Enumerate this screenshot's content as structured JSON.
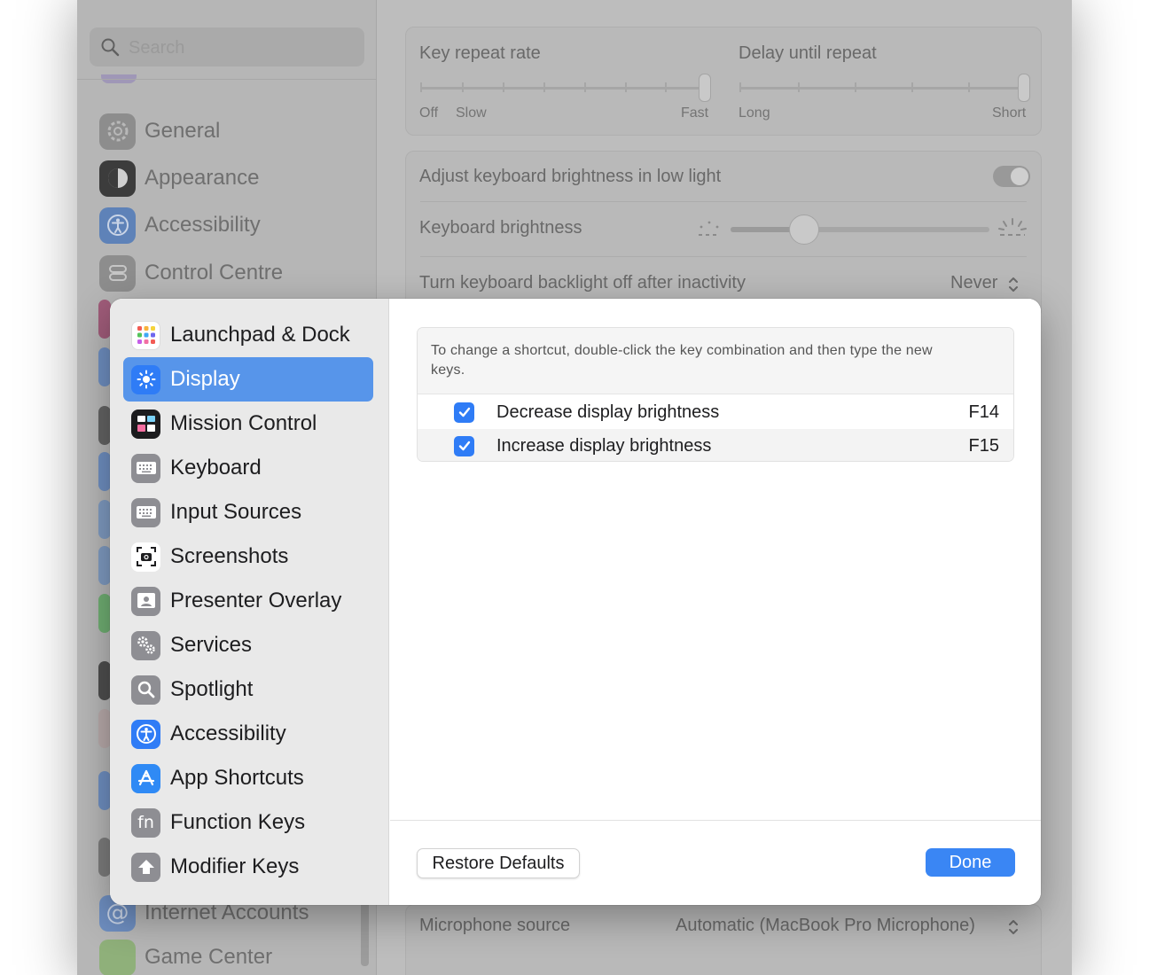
{
  "background": {
    "search_placeholder": "Search",
    "sidebar_items": [
      {
        "label": "General",
        "icon": "gear-icon"
      },
      {
        "label": "Appearance",
        "icon": "appearance-icon"
      },
      {
        "label": "Accessibility",
        "icon": "accessibility-icon"
      },
      {
        "label": "Control Centre",
        "icon": "control-centre-icon"
      },
      {
        "label": "Internet Accounts",
        "icon": "at-sign-icon"
      },
      {
        "label": "Game Center",
        "icon": "game-center-icon"
      }
    ],
    "key_repeat": {
      "title": "Key repeat rate",
      "labels": [
        "Off",
        "Slow",
        "Fast"
      ]
    },
    "delay_repeat": {
      "title": "Delay until repeat",
      "labels": [
        "Long",
        "Short"
      ]
    },
    "adjust_brightness_label": "Adjust keyboard brightness in low light",
    "keyboard_brightness_label": "Keyboard brightness",
    "backlight_off_label": "Turn keyboard backlight off after inactivity",
    "backlight_off_value": "Never",
    "mic_source_label": "Microphone source",
    "mic_source_value": "Automatic (MacBook Pro Microphone)"
  },
  "sheet": {
    "categories": [
      {
        "label": "Launchpad & Dock",
        "icon": "launchpad-icon",
        "selected": false
      },
      {
        "label": "Display",
        "icon": "sun-icon",
        "selected": true
      },
      {
        "label": "Mission Control",
        "icon": "mission-control-icon",
        "selected": false
      },
      {
        "label": "Keyboard",
        "icon": "keyboard-icon",
        "selected": false
      },
      {
        "label": "Input Sources",
        "icon": "keyboard-icon",
        "selected": false
      },
      {
        "label": "Screenshots",
        "icon": "camera-icon",
        "selected": false
      },
      {
        "label": "Presenter Overlay",
        "icon": "person-icon",
        "selected": false
      },
      {
        "label": "Services",
        "icon": "gears-icon",
        "selected": false
      },
      {
        "label": "Spotlight",
        "icon": "magnifier-icon",
        "selected": false
      },
      {
        "label": "Accessibility",
        "icon": "accessibility-icon",
        "selected": false
      },
      {
        "label": "App Shortcuts",
        "icon": "app-store-icon",
        "selected": false
      },
      {
        "label": "Function Keys",
        "icon": "fn-icon",
        "selected": false
      },
      {
        "label": "Modifier Keys",
        "icon": "up-arrow-icon",
        "selected": false
      }
    ],
    "hint": "To change a shortcut, double-click the key combination and then type the new keys.",
    "shortcuts": [
      {
        "label": "Decrease display brightness",
        "key": "F14",
        "checked": true
      },
      {
        "label": "Increase display brightness",
        "key": "F15",
        "checked": true
      }
    ],
    "restore_label": "Restore Defaults",
    "done_label": "Done",
    "accent": "#3a86f4"
  }
}
